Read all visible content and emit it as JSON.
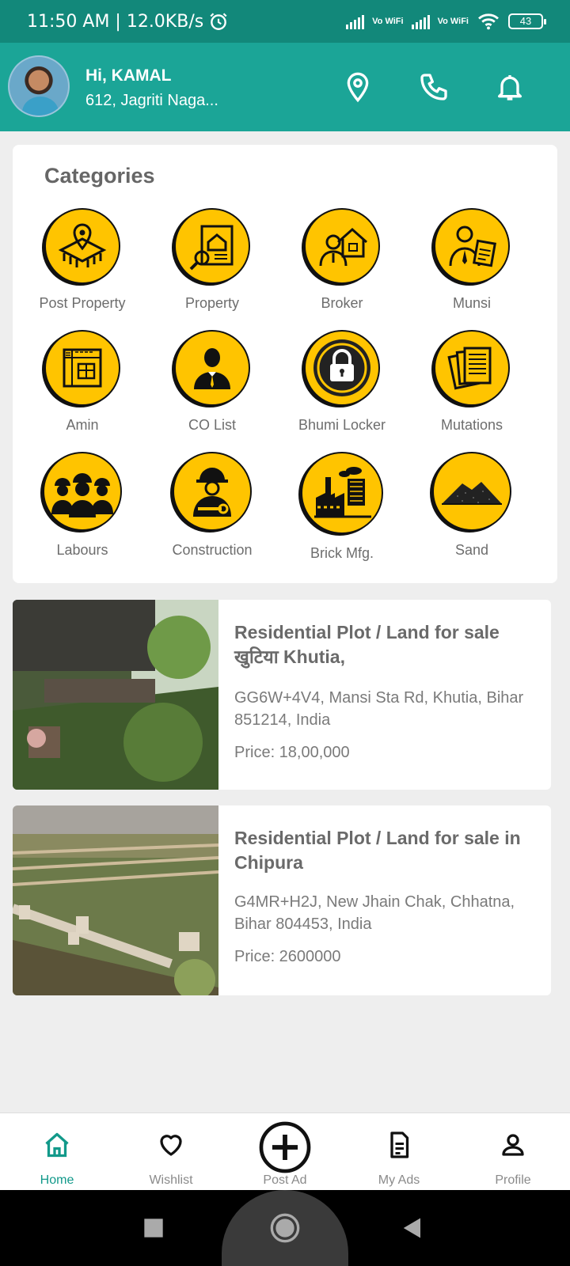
{
  "status_bar": {
    "time": "11:50 AM | 12.0KB/s",
    "signal1_label": "Vo WiFi",
    "signal2_label": "Vo WiFi",
    "battery": "43"
  },
  "header": {
    "greeting": "Hi, KAMAL",
    "address": "612, Jagriti Naga..."
  },
  "categories": {
    "title": "Categories",
    "items": [
      {
        "label": "Post Property",
        "icon": "map-pin-land-icon"
      },
      {
        "label": "Property",
        "icon": "property-search-icon"
      },
      {
        "label": "Broker",
        "icon": "broker-house-icon"
      },
      {
        "label": "Munsi",
        "icon": "clerk-document-icon"
      },
      {
        "label": "Amin",
        "icon": "survey-map-icon"
      },
      {
        "label": "CO List",
        "icon": "officer-icon"
      },
      {
        "label": "Bhumi Locker",
        "icon": "lock-icon"
      },
      {
        "label": "Mutations",
        "icon": "documents-icon"
      },
      {
        "label": "Labours",
        "icon": "workers-icon"
      },
      {
        "label": "Construction",
        "icon": "construction-worker-icon"
      },
      {
        "label": "Brick Mfg.",
        "icon": "factory-icon"
      },
      {
        "label": "Sand",
        "icon": "sand-pile-icon"
      }
    ]
  },
  "listings": [
    {
      "title": "Residential Plot / Land for sale खुटिया Khutia,",
      "location": "GG6W+4V4, Mansi Sta Rd, Khutia, Bihar 851214, India",
      "price": "Price: 18,00,000"
    },
    {
      "title": "Residential Plot / Land for sale in Chipura",
      "location": "G4MR+H2J, New Jhain Chak, Chhatna, Bihar 804453, India",
      "price": "Price: 2600000"
    }
  ],
  "bottom_nav": [
    {
      "label": "Home",
      "icon": "home-icon",
      "active": true
    },
    {
      "label": "Wishlist",
      "icon": "heart-icon"
    },
    {
      "label": "Post Ad",
      "icon": "plus-circle-icon"
    },
    {
      "label": "My Ads",
      "icon": "document-icon"
    },
    {
      "label": "Profile",
      "icon": "user-icon"
    }
  ],
  "colors": {
    "header": "#1ba597",
    "statusbar": "#12887a",
    "accent": "#ffc400",
    "active_nav": "#12998a"
  }
}
